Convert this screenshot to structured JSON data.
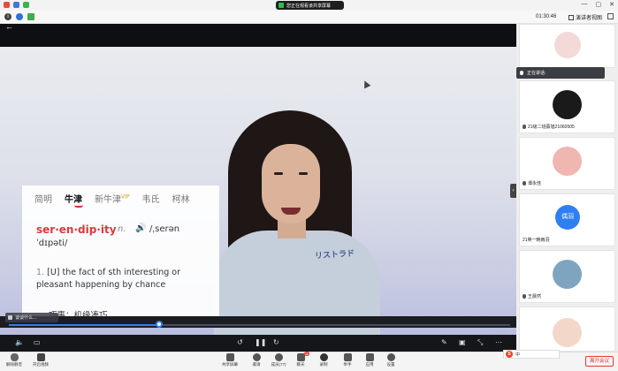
{
  "titlebar": {
    "share_notice": "您正在观看该共享屏幕",
    "window_controls": [
      "—",
      "▢",
      "✕"
    ]
  },
  "toolbar": {
    "elapsed_time": "01:30:46",
    "view_button": "演讲者视图"
  },
  "video": {
    "back_icon": "back-arrow-icon",
    "chat_preview": "谈谈什么...",
    "current_time": "0:05:26",
    "duration": "0:09:03",
    "progress": 0.3,
    "accent_color": "#2f7ff2"
  },
  "dictionary": {
    "tabs": [
      "简明",
      "牛津",
      "新牛津",
      "韦氏",
      "柯林"
    ],
    "active_tab": "牛津",
    "vip": "VIP",
    "headword": "ser·en·dip·ity",
    "pos": "n.",
    "pron_1": "/ˌserən",
    "pron_2": "ˈdɪpəti/",
    "def_num": "1.",
    "def_text": "[U] the fact of sth interesting or pleasant happening by chance",
    "def_cn": "巧事；机缘凑巧"
  },
  "shirt_print": "リストラド",
  "sidebar": {
    "speaking_label": "正在讲话:",
    "participants": [
      {
        "name": "",
        "avatar_color": "#f4d9d9"
      },
      {
        "name": "21级二班蔡旭21060505",
        "avatar_color": "#1a1a1a"
      },
      {
        "name": "谭永佳",
        "avatar_color": "#f0b6b0"
      },
      {
        "name": "21英一韩雨羽",
        "avatar_color": "#2f7ff2",
        "avatar_text": "偶羽"
      },
      {
        "name": "王晨然",
        "avatar_color": "#7fa4bf"
      },
      {
        "name": "",
        "avatar_color": "#f3d7c9"
      }
    ]
  },
  "bottombar": {
    "left": [
      {
        "label": "解除静音",
        "icon": "mic-icon"
      },
      {
        "label": "开启视频",
        "icon": "camera-off-icon"
      }
    ],
    "center": [
      {
        "label": "共享屏幕",
        "icon": "share-screen-icon"
      },
      {
        "label": "邀请",
        "icon": "invite-icon"
      },
      {
        "label": "成员(77)",
        "icon": "members-icon"
      },
      {
        "label": "聊天",
        "icon": "chat-icon",
        "badge": "11"
      },
      {
        "label": "录制",
        "icon": "record-icon"
      },
      {
        "label": "举手",
        "icon": "raise-hand-icon"
      },
      {
        "label": "应用",
        "icon": "apps-icon"
      },
      {
        "label": "设置",
        "icon": "settings-icon"
      }
    ],
    "leave": "离开会议",
    "ime": "中"
  }
}
